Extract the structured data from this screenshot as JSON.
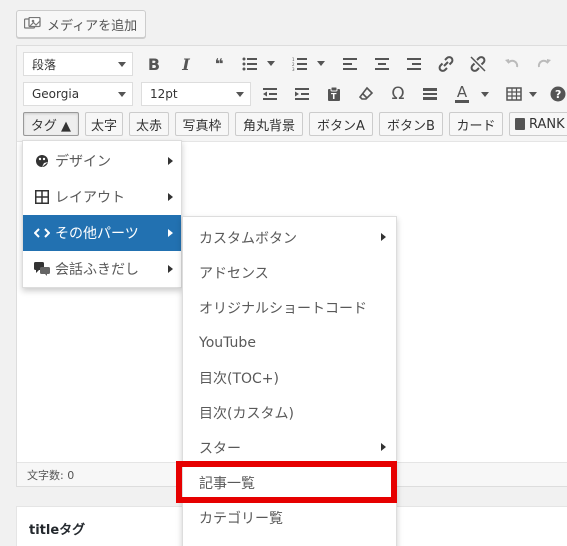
{
  "media_button": {
    "label": "メディアを追加"
  },
  "toolbar": {
    "format_select": "段落",
    "font_family_select": "Georgia",
    "font_size_select": "12pt",
    "bold_label": "B",
    "italic_label": "I",
    "quote_label": "66",
    "special_char_label": "Ω",
    "text_color_label": "A",
    "quicktags": [
      "タグ ▲",
      "太字",
      "太赤",
      "写真枠",
      "角丸背景",
      "ボタンA",
      "ボタンB",
      "カード",
      "RANK"
    ]
  },
  "menu_level1": [
    {
      "label": "デザイン",
      "icon": "palette-icon",
      "has_submenu": true
    },
    {
      "label": "レイアウト",
      "icon": "grid-icon",
      "has_submenu": true
    },
    {
      "label": "その他パーツ",
      "icon": "code-icon",
      "has_submenu": true,
      "active": true
    },
    {
      "label": "会話ふきだし",
      "icon": "chat-bubble-icon",
      "has_submenu": true
    }
  ],
  "menu_level2": [
    {
      "label": "カスタムボタン",
      "has_submenu": true
    },
    {
      "label": "アドセンス",
      "has_submenu": false
    },
    {
      "label": "オリジナルショートコード",
      "has_submenu": false
    },
    {
      "label": "YouTube",
      "has_submenu": false
    },
    {
      "label": "目次(TOC+)",
      "has_submenu": false
    },
    {
      "label": "目次(カスタム)",
      "has_submenu": false
    },
    {
      "label": "スター",
      "has_submenu": true
    },
    {
      "label": "記事一覧",
      "has_submenu": false,
      "highlighted": true
    },
    {
      "label": "カテゴリー覧",
      "has_submenu": false
    }
  ],
  "status": {
    "word_count": "文字数: 0"
  },
  "meta_box": {
    "title": "titleタグ"
  },
  "colors": {
    "accent": "#2271b1",
    "highlight": "#e60000"
  }
}
